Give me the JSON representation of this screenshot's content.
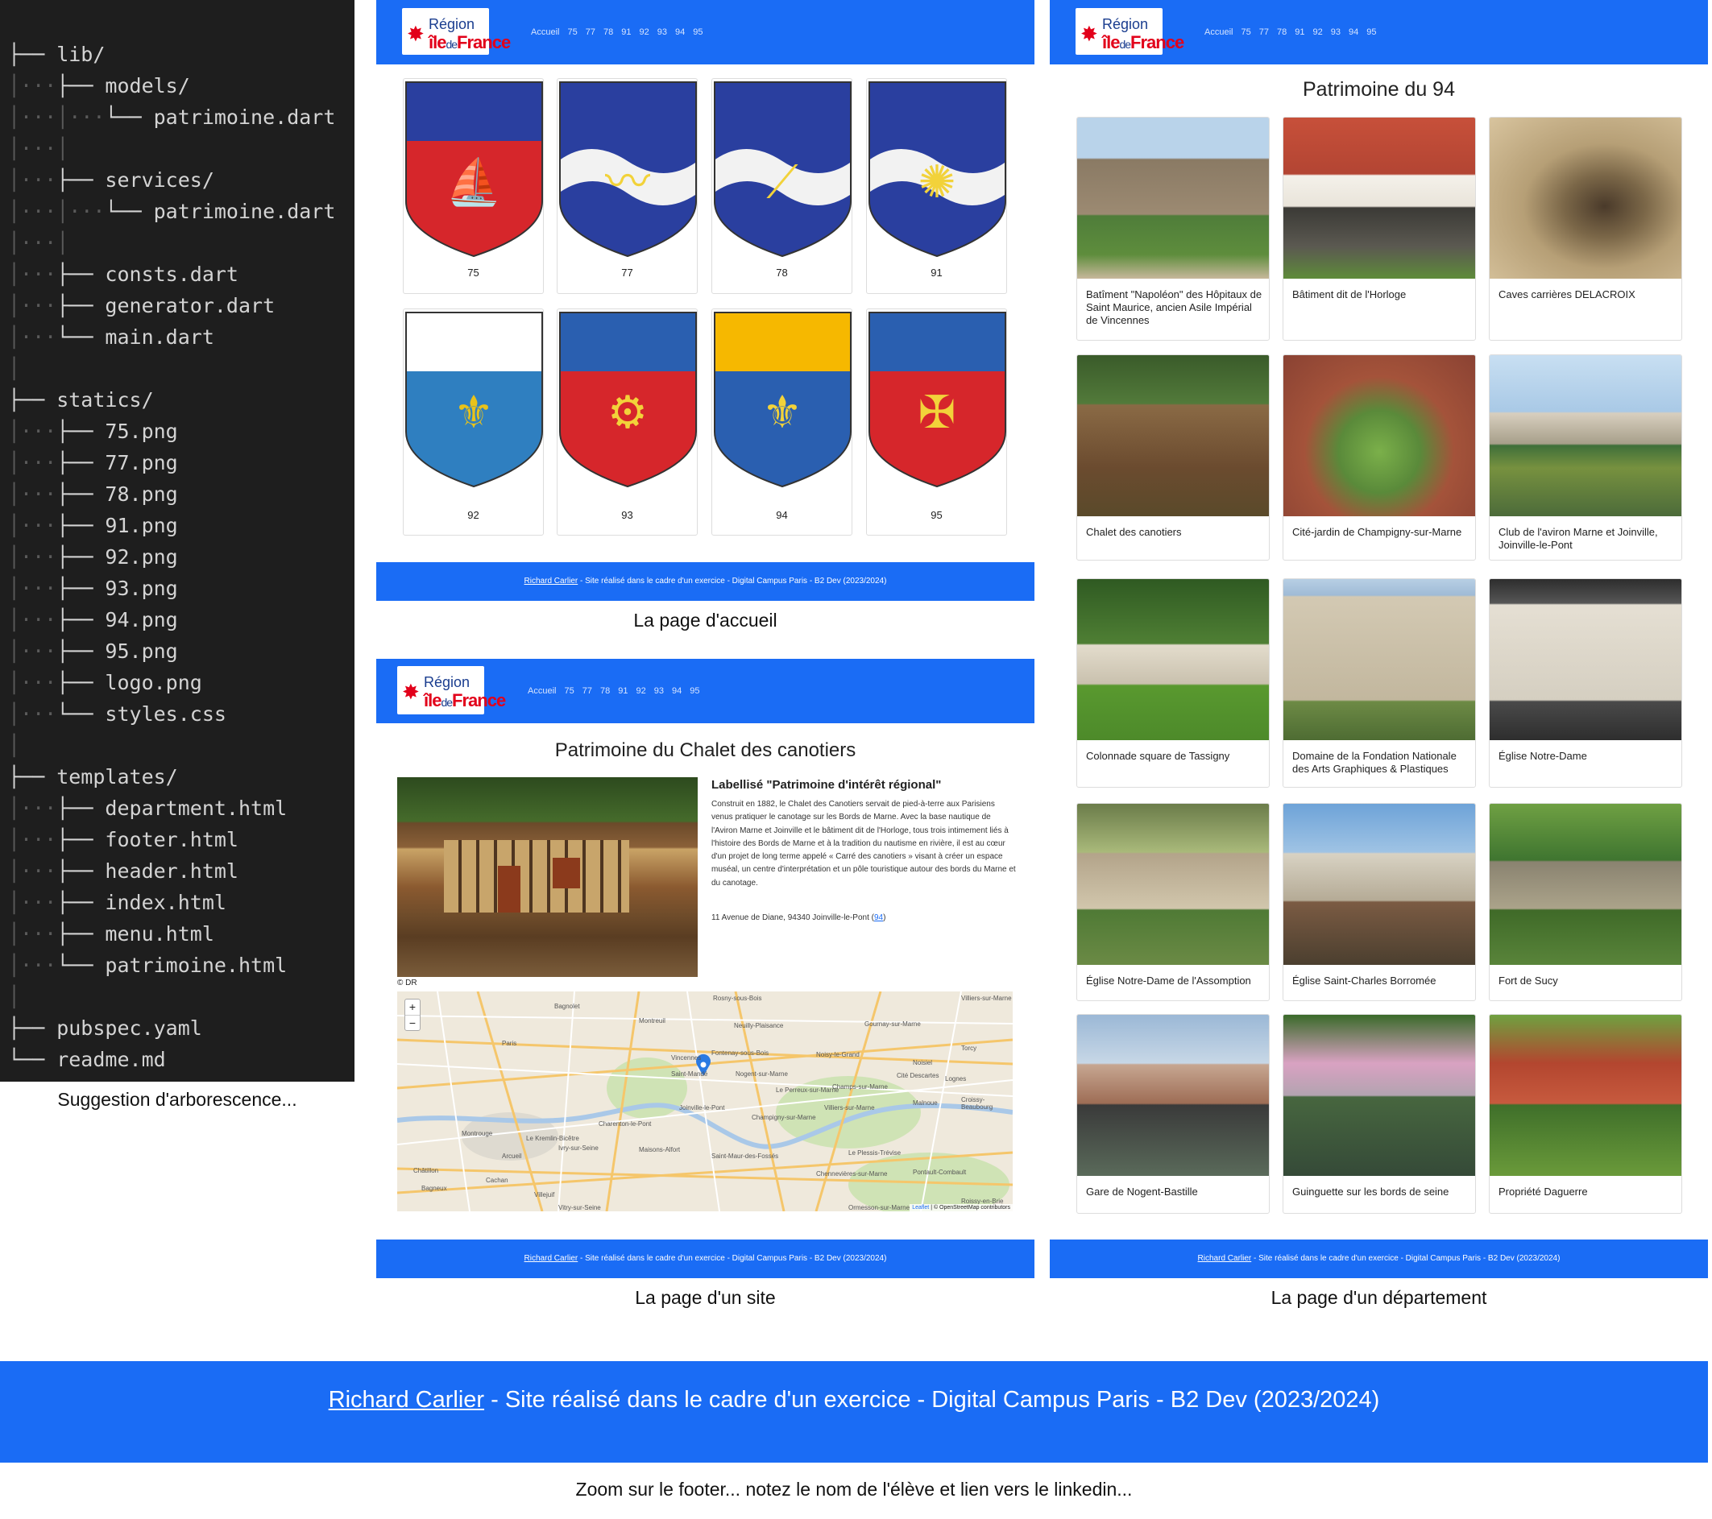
{
  "tree": [
    {
      "g": "",
      "t": "├── lib/"
    },
    {
      "g": "│···",
      "t": "├── models/"
    },
    {
      "g": "│···│···",
      "t": "└── patrimoine.dart"
    },
    {
      "g": "│···│",
      "t": ""
    },
    {
      "g": "│···",
      "t": "├── services/"
    },
    {
      "g": "│···│···",
      "t": "└── patrimoine.dart"
    },
    {
      "g": "│···│",
      "t": ""
    },
    {
      "g": "│···",
      "t": "├── consts.dart"
    },
    {
      "g": "│···",
      "t": "├── generator.dart"
    },
    {
      "g": "│···",
      "t": "└── main.dart"
    },
    {
      "g": "│",
      "t": ""
    },
    {
      "g": "",
      "t": "├── statics/"
    },
    {
      "g": "│···",
      "t": "├── 75.png"
    },
    {
      "g": "│···",
      "t": "├── 77.png"
    },
    {
      "g": "│···",
      "t": "├── 78.png"
    },
    {
      "g": "│···",
      "t": "├── 91.png"
    },
    {
      "g": "│···",
      "t": "├── 92.png"
    },
    {
      "g": "│···",
      "t": "├── 93.png"
    },
    {
      "g": "│···",
      "t": "├── 94.png"
    },
    {
      "g": "│···",
      "t": "├── 95.png"
    },
    {
      "g": "│···",
      "t": "├── logo.png"
    },
    {
      "g": "│···",
      "t": "└── styles.css"
    },
    {
      "g": "│",
      "t": ""
    },
    {
      "g": "",
      "t": "├── templates/"
    },
    {
      "g": "│···",
      "t": "├── department.html"
    },
    {
      "g": "│···",
      "t": "├── footer.html"
    },
    {
      "g": "│···",
      "t": "├── header.html"
    },
    {
      "g": "│···",
      "t": "├── index.html"
    },
    {
      "g": "│···",
      "t": "├── menu.html"
    },
    {
      "g": "│···",
      "t": "└── patrimoine.html"
    },
    {
      "g": "│",
      "t": ""
    },
    {
      "g": "",
      "t": "├── pubspec.yaml"
    },
    {
      "g": "",
      "t": "└── readme.md"
    }
  ],
  "captions": {
    "tree": "Suggestion d'arborescence...",
    "home": "La page d'accueil",
    "site": "La page d'un site",
    "dept": "La page d'un département",
    "zoom": "Zoom sur le footer... notez le nom de l'élève et lien vers le linkedin..."
  },
  "logo": {
    "line1": "Région",
    "line2a": "île",
    "line2b": "de",
    "line2c": "France"
  },
  "nav": [
    "Accueil",
    "75",
    "77",
    "78",
    "91",
    "92",
    "93",
    "94",
    "95"
  ],
  "footer": {
    "author": "Richard Carlier",
    "text": " - Site réalisé dans le cadre d'un exercice - Digital Campus Paris - B2 Dev (2023/2024)"
  },
  "departments": [
    "75",
    "77",
    "78",
    "91",
    "92",
    "93",
    "94",
    "95"
  ],
  "site": {
    "title": "Patrimoine du Chalet des canotiers",
    "label": "Labellisé \"Patrimoine d'intérêt régional\"",
    "desc": "Construit en 1882, le Chalet des Canotiers servait de pied-à-terre aux Parisiens venus pratiquer le canotage sur les Bords de Marne. Avec la base nautique de l'Aviron Marne et Joinville et le bâtiment dit de l'Horloge, tous trois intimement liés à l'histoire des Bords de Marne et à la tradition du nautisme en rivière, il est au cœur d'un projet de long terme appelé « Carré des canotiers » visant à créer un espace muséal, un centre d'interprétation et un pôle touristique autour des bords du Marne et du canotage.",
    "address": "11 Avenue de Diane, 94340 Joinville-le-Pont (",
    "address_link": "94",
    "address_end": ")",
    "credit": "© DR",
    "map_attrib_leaflet": "Leaflet",
    "map_attrib_osm": " | © OpenStreetMap contributors",
    "zoom_in": "+",
    "zoom_out": "−",
    "map_labels": [
      "Bagnolet",
      "Montreuil",
      "Rosny-sous-Bois",
      "Villiers-sur-Marne",
      "Neuilly-Plaisance",
      "Gournay-sur-Marne",
      "Paris",
      "Vincennes",
      "Fontenay-sous-Bois",
      "Noisy-le-Grand",
      "Torcy",
      "Nogent-sur-Marne",
      "Le Perreux-sur-Marne",
      "Noisiel",
      "Saint-Mandé",
      "Champs-sur-Marne",
      "Cité Descartes",
      "Lognes",
      "Charenton-le-Pont",
      "Joinville-le-Pont",
      "Champigny-sur-Marne",
      "Villiers-sur-Marne",
      "Malnoue",
      "Croissy-Beaubourg",
      "Montrouge",
      "Ivry-sur-Seine",
      "Le Kremlin-Bicêtre",
      "Maisons-Alfort",
      "Saint-Maur-des-Fossés",
      "Le Plessis-Trévise",
      "Pontault-Combault",
      "Arcueil",
      "Chennevières-sur-Marne",
      "Cachan",
      "Villejuif",
      "Vitry-sur-Seine",
      "Châtillon",
      "Bagneux",
      "Ormesson-sur-Marne",
      "Roissy-en-Brie"
    ]
  },
  "dept_page": {
    "title": "Patrimoine du 94",
    "items": [
      "Batîment \"Napoléon\" des Hôpitaux de Saint Maurice, ancien Asile Impérial de Vincennes",
      "Bâtiment dit de l'Horloge",
      "Caves carrières DELACROIX",
      "Chalet des canotiers",
      "Cité-jardin de Champigny-sur-Marne",
      "Club de l'aviron Marne et Joinville, Joinville-le-Pont",
      "Colonnade square de Tassigny",
      "Domaine de la Fondation Nationale des Arts Graphiques & Plastiques",
      "Église Notre-Dame",
      "Église Notre-Dame de l'Assomption",
      "Église Saint-Charles Borromée",
      "Fort de Sucy",
      "Gare de Nogent-Bastille",
      "Guinguette sur les bords de seine",
      "Propriété Daguerre"
    ]
  },
  "colors": {
    "accent": "#1a6cf5",
    "tree_bg": "#1e1e1e",
    "red": "#e2001a",
    "navy": "#1a3d8f"
  }
}
